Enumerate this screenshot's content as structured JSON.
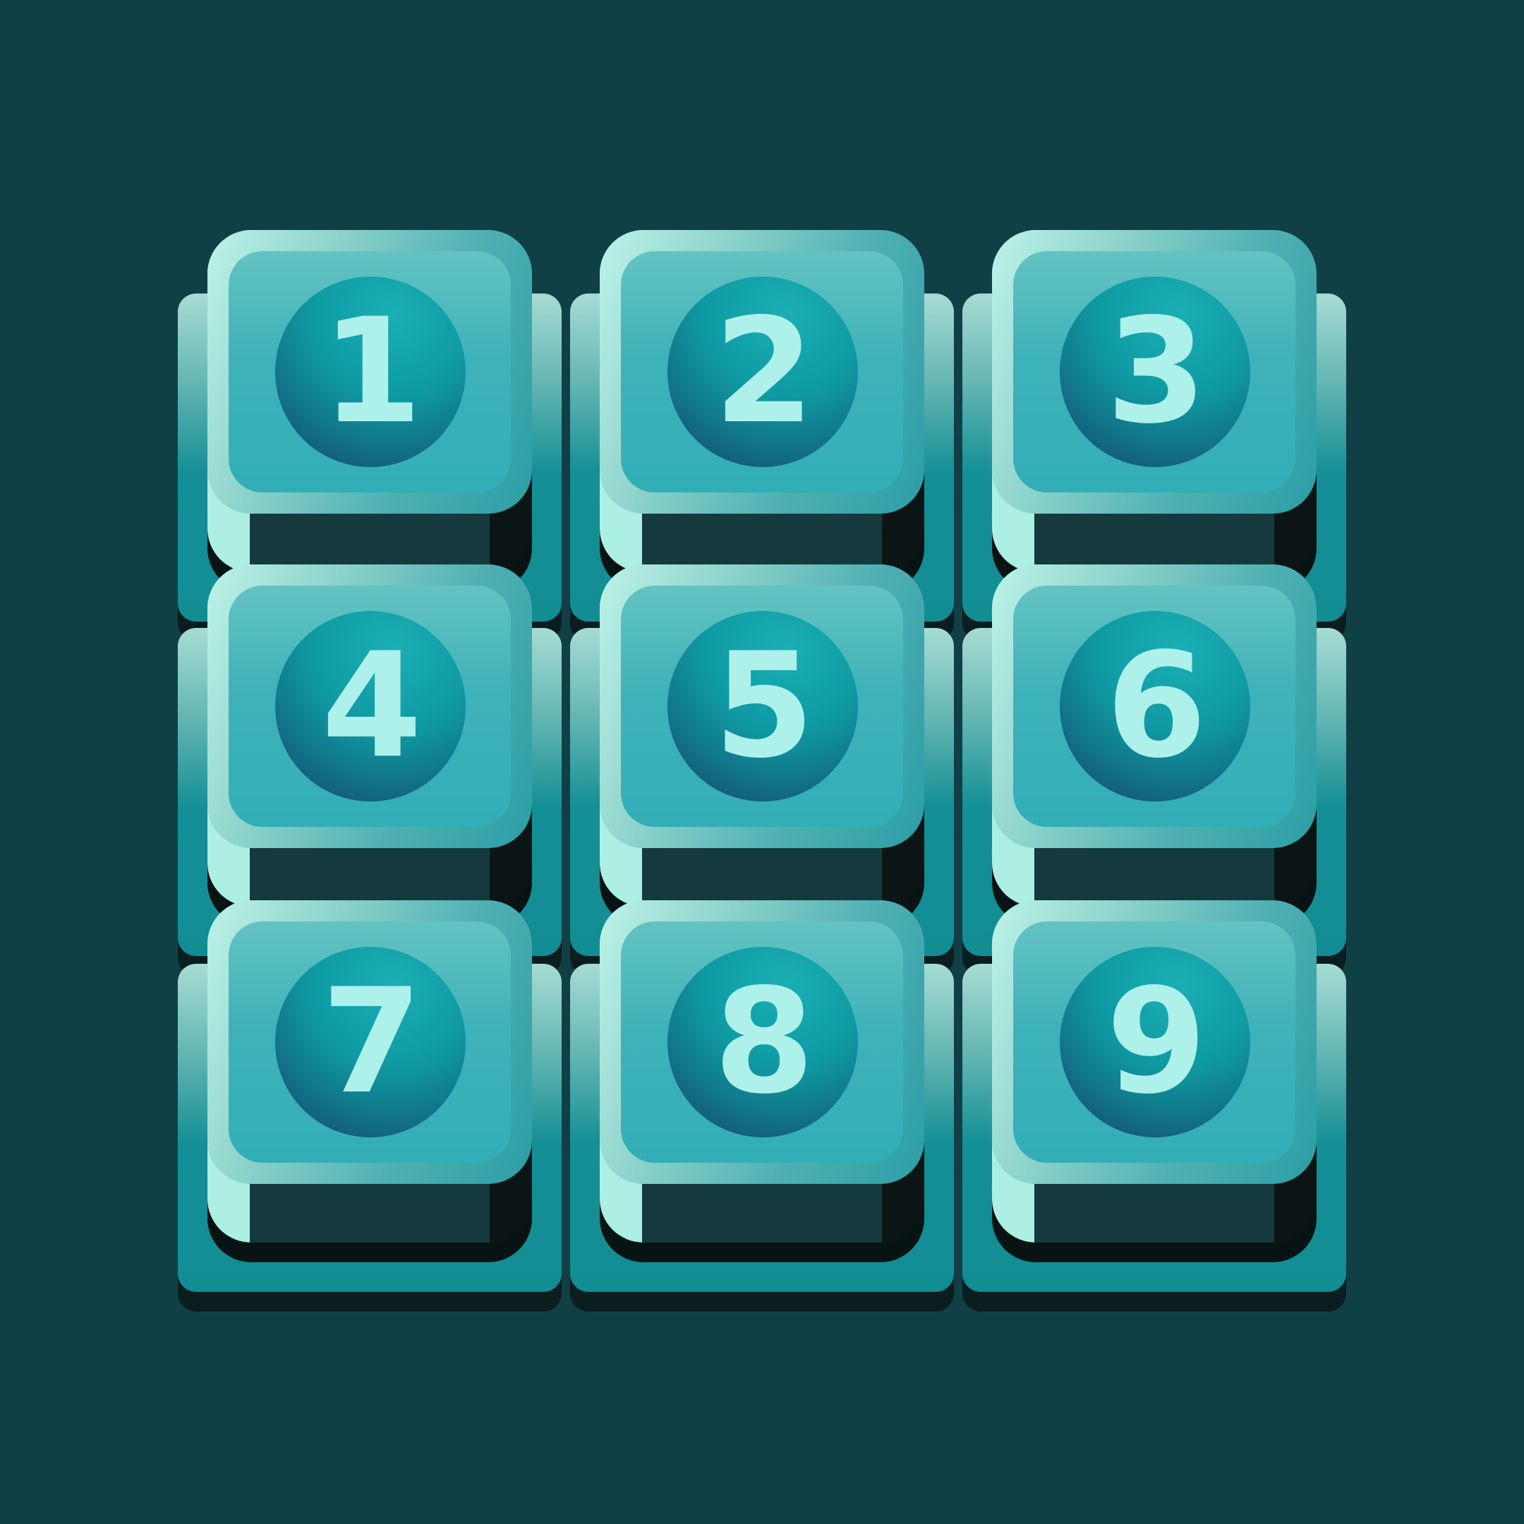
{
  "keypad": {
    "keys": [
      {
        "label": "1"
      },
      {
        "label": "2"
      },
      {
        "label": "3"
      },
      {
        "label": "4"
      },
      {
        "label": "5"
      },
      {
        "label": "6"
      },
      {
        "label": "7"
      },
      {
        "label": "8"
      },
      {
        "label": "9"
      }
    ]
  },
  "colors": {
    "background": "#104046",
    "digit": "#aef0ea",
    "cap_highlight": "#bdf3e8",
    "cap_face": "#3eb2b9",
    "knob_center": "#0f9aa3",
    "knob_edge": "#17416b"
  }
}
